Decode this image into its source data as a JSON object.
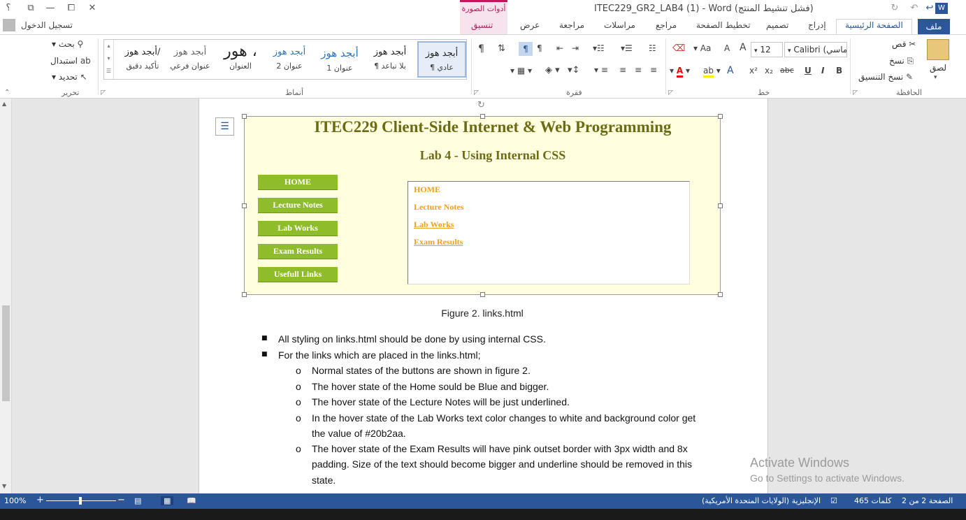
{
  "window": {
    "title": "ITEC229_GR2_LAB4 (1) - Word (فشل تنشيط المنتج)",
    "quick_access": [
      "؟",
      "⧉",
      "—",
      "⧠",
      "✕"
    ],
    "picture_tools": "أدوات الصورة",
    "sign_in": "تسجيل الدخول"
  },
  "tabs": {
    "file": "ملف",
    "items": [
      "الصفحة الرئيسية",
      "إدراج",
      "تصميم",
      "تخطيط الصفحة",
      "مراجع",
      "مراسلات",
      "مراجعة",
      "عرض",
      "تنسيق"
    ]
  },
  "ribbon": {
    "clipboard": {
      "paste": "لصق",
      "cut": "قص",
      "copy": "نسخ",
      "format_painter": "نسخ التنسيق",
      "group": "الحافظة"
    },
    "font": {
      "name": "Calibri (ماسي)",
      "size": "12",
      "group": "خط",
      "bold": "B",
      "italic": "I",
      "underline": "U",
      "strike": "abc",
      "sub": "x₂",
      "sup": "x²",
      "grow": "A",
      "shrink": "A",
      "case": "Aa"
    },
    "paragraph": {
      "group": "فقرة"
    },
    "styles": {
      "group": "أنماط",
      "items": [
        {
          "preview": "أبجد هوز",
          "name": "¶ عادي"
        },
        {
          "preview": "أبجد هوز",
          "name": "¶ بلا تباعد"
        },
        {
          "preview": "أبجد هوز",
          "name": "عنوان 1"
        },
        {
          "preview": "أبجد هوز",
          "name": "عنوان 2"
        },
        {
          "preview": "هور ،",
          "name": "العنوان"
        },
        {
          "preview": "أبجد هوز",
          "name": "عنوان فرعي"
        },
        {
          "preview": "أبجد هوز/",
          "name": "تأكيد دقيق"
        }
      ]
    },
    "editing": {
      "find": "بحث",
      "replace": "استبدال",
      "select": "تحديد",
      "group": "تحرير"
    }
  },
  "figure": {
    "title": "ITEC229 Client-Side Internet & Web Programming",
    "subtitle": "Lab 4 - Using Internal CSS",
    "nav_buttons": [
      "HOME",
      "Lecture Notes",
      "Lab Works",
      "Exam Results",
      "Usefull Links"
    ],
    "frame_links": [
      "HOME",
      "Lecture Notes",
      "Lab Works",
      "Exam Results"
    ],
    "caption": "Figure 2. links.html"
  },
  "body": {
    "bullets": [
      "All styling on links.html should be done by using internal CSS.",
      "For the links which are placed in the links.html;"
    ],
    "sub_bullets": [
      "Normal states of the buttons are shown in figure 2.",
      "The hover state of the Home sould be Blue and bigger.",
      "The hover state of the Lecture Notes will be just underlined.",
      "In the hover state of the Lab Works text color changes to white and background color get",
      "the value of #20b2aa.",
      "The hover state of the Exam Results will have pink outset border with 3px width and 8x",
      "padding. Size of the text should become bigger and underline should be removed in this",
      "state."
    ]
  },
  "activation": {
    "line1": "Activate Windows",
    "line2": "Go to Settings to activate Windows."
  },
  "status": {
    "page": "الصفحة 2 من 2",
    "words": "465 كلمات",
    "language": "الإنجليزية (الولايات المتحدة الأمريكية)",
    "zoom": "100%"
  },
  "colors": {
    "accent": "#2b579a",
    "figure_bg": "#ffffe0",
    "nav_green": "#8fbc2b",
    "link_orange": "#f0a020",
    "title_olive": "#6b6b16"
  }
}
